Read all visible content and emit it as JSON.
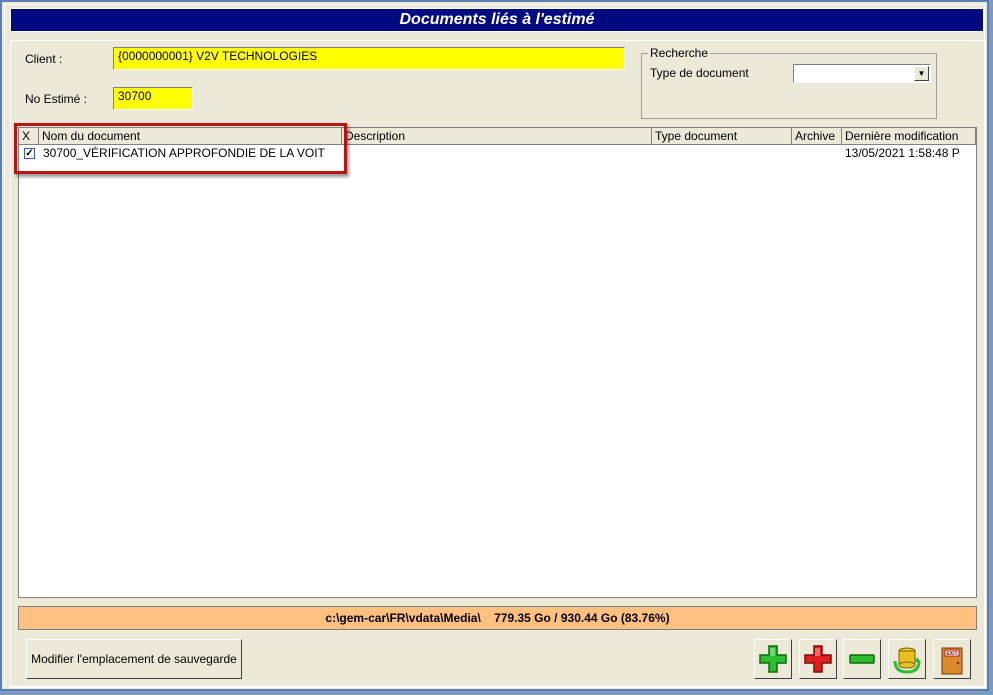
{
  "window": {
    "title": "Documents liés à l'estimé"
  },
  "form": {
    "client_label": "Client :",
    "client_value": "{0000000001} V2V TECHNOLOGIES",
    "estimate_label": "No Estimé :",
    "estimate_value": "30700"
  },
  "search": {
    "group_title": "Recherche",
    "doc_type_label": "Type de document",
    "doc_type_value": ""
  },
  "table": {
    "columns": [
      "X",
      "Nom du document",
      "Description",
      "Type document",
      "Archive",
      "Dernière modification"
    ],
    "rows": [
      {
        "checked": true,
        "name": "30700_VÉRIFICATION APPROFONDIE DE LA VOIT",
        "description": "",
        "type": "",
        "archive": "",
        "modified": "13/05/2021 1:58:48 P"
      }
    ]
  },
  "status": {
    "text": "c:\\gem-car\\FR\\vdata\\Media\\    779.35 Go / 930.44 Go (83.76%)"
  },
  "buttons": {
    "modify_location": "Modifier l'emplacement de sauvegarde",
    "exit_label": "EXIT"
  },
  "colors": {
    "title_bg": "#000a80",
    "field_bg": "#ffff00",
    "status_bg": "#ffc080",
    "highlight": "#b81414"
  },
  "icons": [
    "add-icon",
    "delete-icon",
    "remove-icon",
    "database-sync-icon",
    "exit-door-icon"
  ]
}
